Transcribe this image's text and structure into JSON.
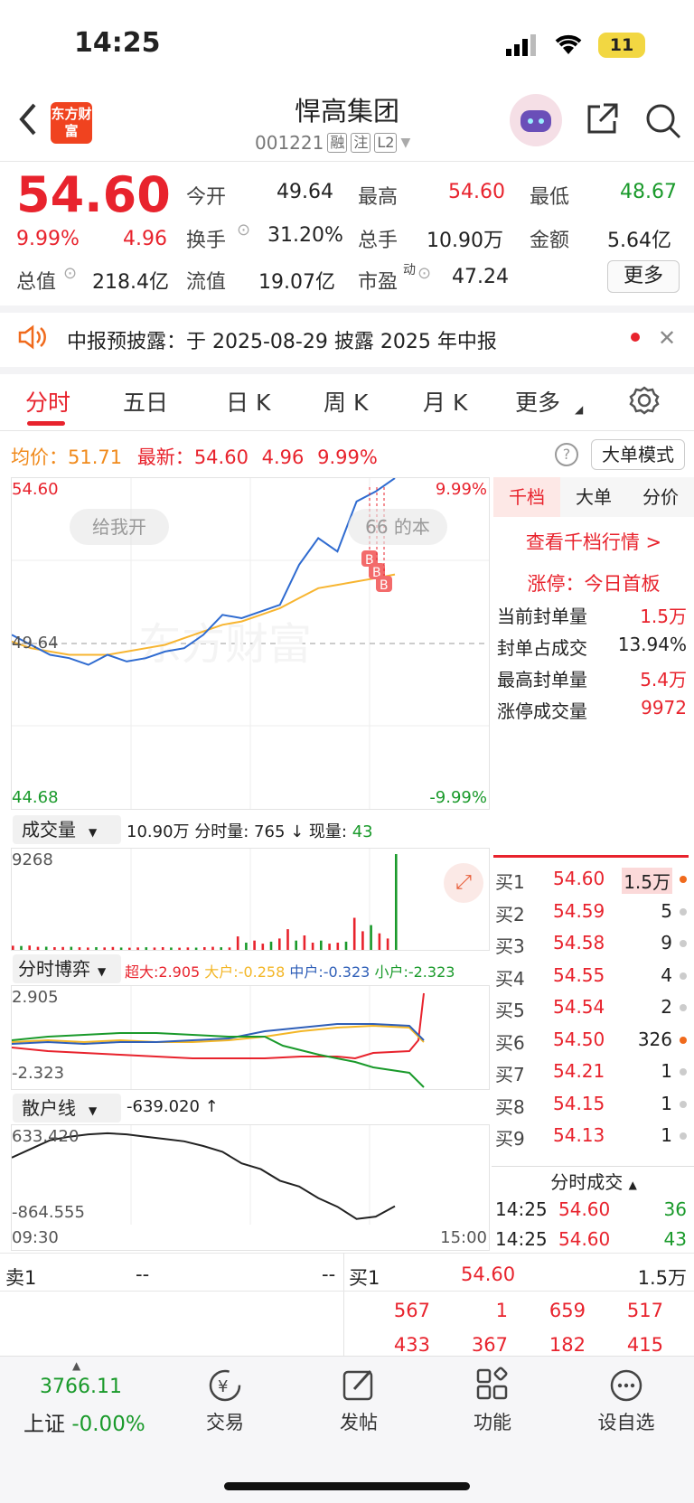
{
  "status_bar": {
    "time": "14:25",
    "battery": "11"
  },
  "header": {
    "title": "悍高集团",
    "code": "001221",
    "tags": [
      "融",
      "注",
      "L2"
    ],
    "logo": "东方财富"
  },
  "quote": {
    "price": "54.60",
    "change_pct": "9.99%",
    "change": "4.96",
    "open_label": "今开",
    "open": "49.64",
    "high_label": "最高",
    "high": "54.60",
    "low_label": "最低",
    "low": "48.67",
    "turnover_label": "换手",
    "turnover": "31.20%",
    "volume_label": "总手",
    "volume": "10.90万",
    "amount_label": "金额",
    "amount": "5.64亿",
    "mktcap_label": "总值",
    "mktcap": "218.4亿",
    "float_label": "流值",
    "float_cap": "19.07亿",
    "pe_label": "市盈",
    "pe_sup": "动",
    "pe": "47.24",
    "more": "更多"
  },
  "notice": {
    "text": "中报预披露：于 2025-08-29 披露 2025 年中报"
  },
  "tabs": [
    "分时",
    "五日",
    "日 K",
    "周 K",
    "月 K",
    "更多"
  ],
  "chart_info": {
    "avg_label": "均价：",
    "avg": "51.71",
    "latest_label": "最新：",
    "latest": "54.60",
    "chg": "4.96",
    "pct": "9.99%",
    "mode_btn": "大单模式"
  },
  "chart": {
    "y_top": "54.60",
    "y_mid": "49.64",
    "y_bot": "44.68",
    "pct_top": "9.99%",
    "pct_bot": "-9.99%",
    "bubble_left": "给我开",
    "bubble_right": "66 的本",
    "watermark": "东方财富",
    "buy_marks": [
      "B",
      "B",
      "B"
    ]
  },
  "chart_data": [
    {
      "type": "line",
      "title": "",
      "x_range": [
        "09:30",
        "15:00"
      ],
      "ylim": [
        44.68,
        54.6
      ],
      "series": [
        {
          "name": "",
          "color": "#2f6bd0",
          "values": [
            49.9,
            49.6,
            49.3,
            49.2,
            49.0,
            49.3,
            49.1,
            49.2,
            49.4,
            49.5,
            49.9,
            50.5,
            50.4,
            50.6,
            50.8,
            52.0,
            52.8,
            52.4,
            53.9,
            54.2,
            54.6
          ]
        },
        {
          "name": "均价",
          "color": "#f7b531",
          "values": [
            49.7,
            49.5,
            49.4,
            49.3,
            49.3,
            49.3,
            49.4,
            49.5,
            49.6,
            49.8,
            50.0,
            50.2,
            50.3,
            50.5,
            50.7,
            51.0,
            51.3,
            51.4,
            51.5,
            51.6,
            51.71
          ]
        }
      ]
    },
    {
      "type": "bar",
      "title": "成交量",
      "ylim": [
        0,
        9268
      ],
      "values": [
        400,
        380,
        420,
        300,
        310,
        260,
        280,
        300,
        250,
        230,
        260,
        240,
        280,
        230,
        210,
        240,
        250,
        230,
        260,
        230,
        210,
        240,
        220,
        260,
        300,
        250,
        240,
        1300,
        700,
        900,
        600,
        800,
        1100,
        2000,
        900,
        1400,
        700,
        900,
        600,
        700,
        800,
        3100,
        1800,
        2400,
        1600,
        1100,
        9268
      ]
    },
    {
      "type": "line",
      "title": "分时博弈",
      "ylim": [
        -2.323,
        2.905
      ],
      "series": [
        {
          "name": "超大",
          "value": "2.905",
          "color": "#e8232d"
        },
        {
          "name": "大户",
          "value": "-0.258",
          "color": "#f3b626"
        },
        {
          "name": "中户",
          "value": "-0.323",
          "color": "#2f5fb8"
        },
        {
          "name": "小户",
          "value": "-2.323",
          "color": "#1a9a2b"
        }
      ]
    },
    {
      "type": "line",
      "title": "散户线",
      "ylim": [
        -864.555,
        633.42
      ],
      "series": [
        {
          "name": "散户线",
          "value": "-639.020",
          "color": "#222",
          "values": [
            200,
            350,
            500,
            560,
            600,
            620,
            600,
            560,
            520,
            480,
            400,
            300,
            100,
            0,
            -200,
            -300,
            -500,
            -650,
            -860,
            -820,
            -640
          ]
        }
      ]
    }
  ],
  "volume_panel": {
    "label": "成交量",
    "summary": "10.90万 分时量: 765 ↓ 现量:",
    "now_vol": "43",
    "ymax": "9268"
  },
  "game_panel": {
    "label": "分时博弈",
    "super": "超大:2.905",
    "big": "大户:-0.258",
    "mid": "中户:-0.323",
    "small": "小户:-2.323",
    "ymax": "2.905",
    "ymin": "-2.323"
  },
  "retail_panel": {
    "label": "散户线",
    "value": "-639.020 ↑",
    "ymax": "633.420",
    "ymin": "-864.555",
    "t_start": "09:30",
    "t_end": "15:00"
  },
  "side": {
    "tabs": [
      "千档",
      "大单",
      "分价"
    ],
    "link": "查看千档行情 >",
    "limit": "涨停：今日首板",
    "stats": [
      {
        "label": "当前封单量",
        "value": "1.5万"
      },
      {
        "label": "封单占成交",
        "value": "13.94%"
      },
      {
        "label": "最高封单量",
        "value": "5.4万"
      },
      {
        "label": "涨停成交量",
        "value": "9972"
      }
    ],
    "book": [
      {
        "label": "买1",
        "price": "54.60",
        "vol": "1.5万"
      },
      {
        "label": "买2",
        "price": "54.59",
        "vol": "5"
      },
      {
        "label": "买3",
        "price": "54.58",
        "vol": "9"
      },
      {
        "label": "买4",
        "price": "54.55",
        "vol": "4"
      },
      {
        "label": "买5",
        "price": "54.54",
        "vol": "2"
      },
      {
        "label": "买6",
        "price": "54.50",
        "vol": "326"
      },
      {
        "label": "买7",
        "price": "54.21",
        "vol": "1"
      },
      {
        "label": "买8",
        "price": "54.15",
        "vol": "1"
      },
      {
        "label": "买9",
        "price": "54.13",
        "vol": "1"
      }
    ],
    "trades_title": "分时成交",
    "trades": [
      {
        "time": "14:25",
        "price": "54.60",
        "vol": "36"
      },
      {
        "time": "14:25",
        "price": "54.60",
        "vol": "43"
      }
    ]
  },
  "bottom_book": {
    "sell_label": "卖1",
    "sell_price": "--",
    "sell_vol": "--",
    "buy_label": "买1",
    "buy_price": "54.60",
    "buy_vol": "1.5万",
    "row1": [
      "567",
      "1",
      "659",
      "517"
    ],
    "row2": [
      "433",
      "367",
      "182",
      "415"
    ]
  },
  "nav": {
    "index_value": "3766.11",
    "index_name": "上证",
    "index_change": "-0.00%",
    "items": [
      {
        "label": "交易",
        "icon": "yen-circle-icon"
      },
      {
        "label": "发帖",
        "icon": "edit-icon"
      },
      {
        "label": "功能",
        "icon": "grid-icon"
      },
      {
        "label": "设自选",
        "icon": "more-circle-icon"
      }
    ]
  }
}
